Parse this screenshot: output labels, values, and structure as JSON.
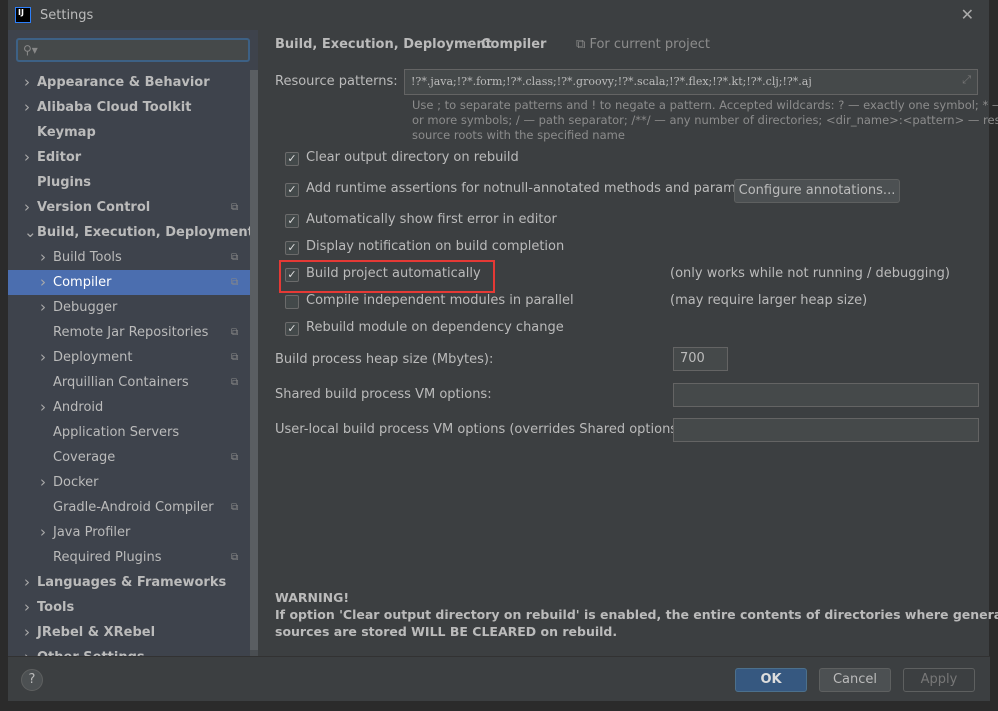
{
  "window": {
    "title": "Settings",
    "logo": "IJ"
  },
  "search": {
    "placeholder": ""
  },
  "sidebar": {
    "items": [
      {
        "label": "Appearance & Behavior",
        "level": 0,
        "chevron": true,
        "bold": true,
        "project": false
      },
      {
        "label": "Alibaba Cloud Toolkit",
        "level": 0,
        "chevron": true,
        "bold": true,
        "project": false
      },
      {
        "label": "Keymap",
        "level": 0,
        "chevron": false,
        "bold": true,
        "project": false
      },
      {
        "label": "Editor",
        "level": 0,
        "chevron": true,
        "bold": true,
        "project": false
      },
      {
        "label": "Plugins",
        "level": 0,
        "chevron": false,
        "bold": true,
        "project": false
      },
      {
        "label": "Version Control",
        "level": 0,
        "chevron": true,
        "bold": true,
        "project": true
      },
      {
        "label": "Build, Execution, Deployment",
        "level": 0,
        "chevron": true,
        "expanded": true,
        "bold": true,
        "project": false
      },
      {
        "label": "Build Tools",
        "level": 1,
        "chevron": true,
        "project": true
      },
      {
        "label": "Compiler",
        "level": 1,
        "chevron": true,
        "project": true,
        "selected": true
      },
      {
        "label": "Debugger",
        "level": 1,
        "chevron": true,
        "project": false
      },
      {
        "label": "Remote Jar Repositories",
        "level": 1,
        "chevron": false,
        "project": true
      },
      {
        "label": "Deployment",
        "level": 1,
        "chevron": true,
        "project": true
      },
      {
        "label": "Arquillian Containers",
        "level": 1,
        "chevron": false,
        "project": true
      },
      {
        "label": "Android",
        "level": 1,
        "chevron": true,
        "project": false
      },
      {
        "label": "Application Servers",
        "level": 1,
        "chevron": false,
        "project": false
      },
      {
        "label": "Coverage",
        "level": 1,
        "chevron": false,
        "project": true
      },
      {
        "label": "Docker",
        "level": 1,
        "chevron": true,
        "project": false
      },
      {
        "label": "Gradle-Android Compiler",
        "level": 1,
        "chevron": false,
        "project": true
      },
      {
        "label": "Java Profiler",
        "level": 1,
        "chevron": true,
        "project": false
      },
      {
        "label": "Required Plugins",
        "level": 1,
        "chevron": false,
        "project": true
      },
      {
        "label": "Languages & Frameworks",
        "level": 0,
        "chevron": true,
        "bold": true,
        "project": false
      },
      {
        "label": "Tools",
        "level": 0,
        "chevron": true,
        "bold": true,
        "project": false
      },
      {
        "label": "JRebel & XRebel",
        "level": 0,
        "chevron": true,
        "bold": true,
        "project": false
      },
      {
        "label": "Other Settings",
        "level": 0,
        "chevron": true,
        "bold": true,
        "project": false
      }
    ]
  },
  "breadcrumb": {
    "parent": "Build, Execution, Deployment",
    "sep": "›",
    "current": "Compiler",
    "scope": "For current project"
  },
  "resource": {
    "label": "Resource patterns:",
    "value": "!?*.java;!?*.form;!?*.class;!?*.groovy;!?*.scala;!?*.flex;!?*.kt;!?*.clj;!?*.aj",
    "hint1": "Use ; to separate patterns and ! to negate a pattern. Accepted wildcards: ? — exactly one symbol; * — zero",
    "hint2": "or more symbols; / — path separator; /**/ — any number of directories; <dir_name>:<pattern> — restrict to",
    "hint3": "source roots with the specified name"
  },
  "options": [
    {
      "label": "Clear output directory on rebuild",
      "checked": true,
      "note": ""
    },
    {
      "label": "Add runtime assertions for notnull-annotated methods and parameters",
      "checked": true,
      "note": ""
    },
    {
      "label": "Automatically show first error in editor",
      "checked": true,
      "note": ""
    },
    {
      "label": "Display notification on build completion",
      "checked": true,
      "note": ""
    },
    {
      "label": "Build project automatically",
      "checked": true,
      "note": "(only works while not running / debugging)",
      "highlighted": true
    },
    {
      "label": "Compile independent modules in parallel",
      "checked": false,
      "note": "(may require larger heap size)"
    },
    {
      "label": "Rebuild module on dependency change",
      "checked": true,
      "note": ""
    }
  ],
  "configure_button": "Configure annotations...",
  "heap": {
    "label": "Build process heap size (Mbytes):",
    "value": "700"
  },
  "shared_vm": {
    "label": "Shared build process VM options:",
    "value": ""
  },
  "local_vm": {
    "label": "User-local build process VM options (overrides Shared options):",
    "value": ""
  },
  "warning": {
    "title": "WARNING!",
    "line1": "If option 'Clear output directory on rebuild' is enabled, the entire contents of directories where generated",
    "line2": "sources are stored WILL BE CLEARED on rebuild."
  },
  "footer": {
    "help": "?",
    "ok": "OK",
    "cancel": "Cancel",
    "apply": "Apply"
  },
  "colors": {
    "accent": "#4b6eaf",
    "highlight": "#e53935"
  }
}
